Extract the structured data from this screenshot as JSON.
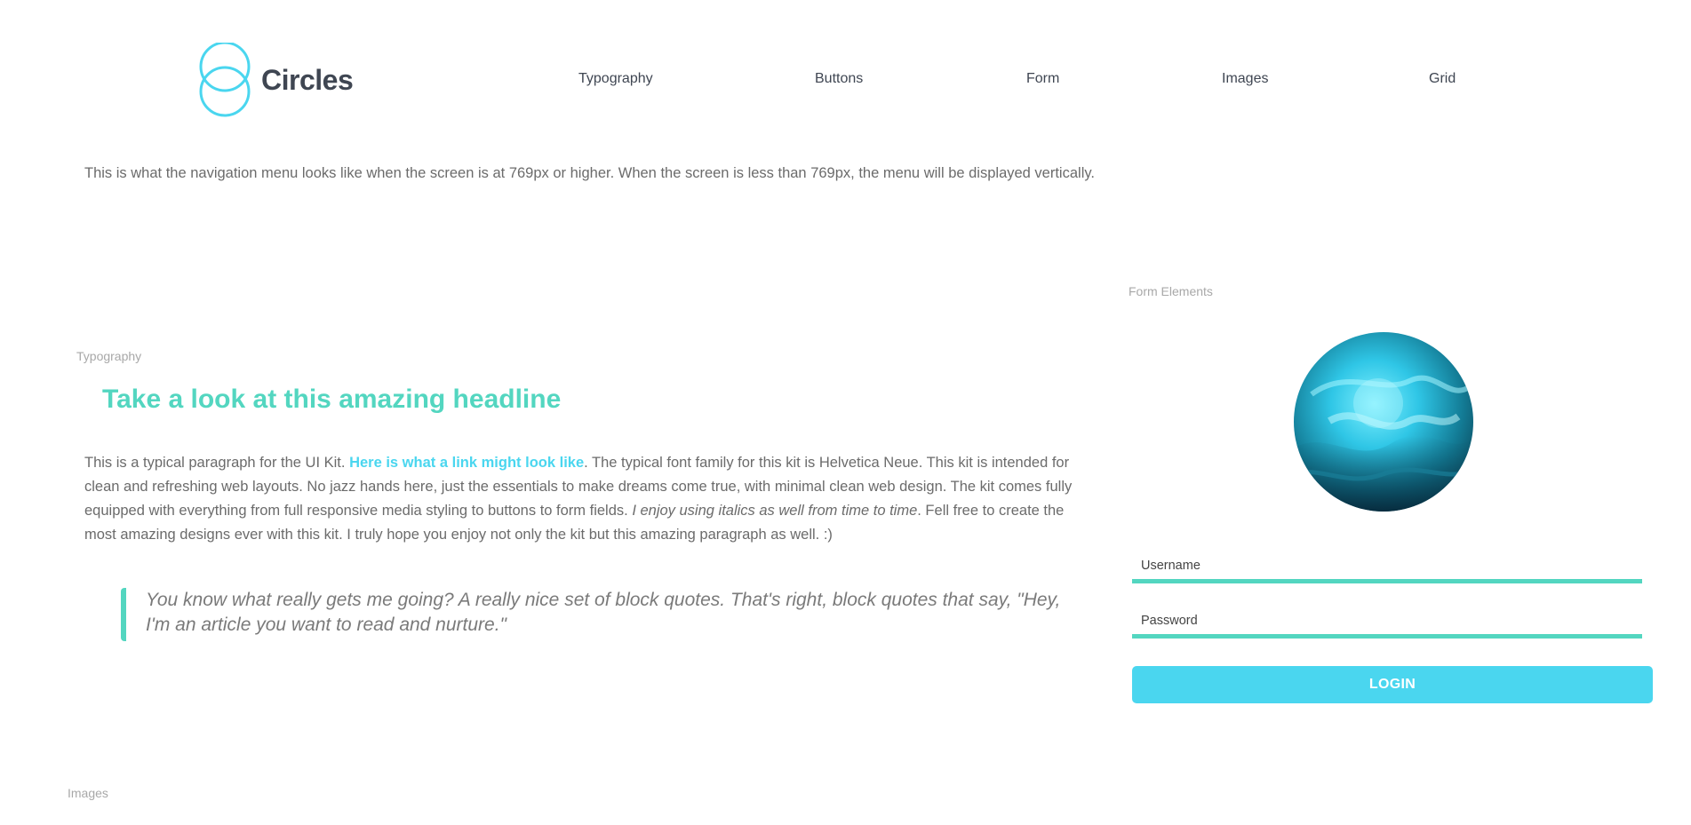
{
  "brand": {
    "name": "Circles",
    "accent": "#4ad6ef",
    "secondary": "#53d6c0"
  },
  "nav": {
    "items": [
      {
        "label": "Typography"
      },
      {
        "label": "Buttons"
      },
      {
        "label": "Form"
      },
      {
        "label": "Images"
      },
      {
        "label": "Grid"
      }
    ],
    "note": "This is what the navigation menu looks like when the screen is at 769px or higher. When the screen is less than 769px, the menu will be displayed vertically."
  },
  "typography": {
    "section_label": "Typography",
    "headline": "Take a look at this amazing headline",
    "para_part1": "This is a typical paragraph for the UI Kit. ",
    "link_text": "Here is what a link might look like",
    "para_part2": ". The typical font family for this kit is Helvetica Neue. This kit is intended for clean and refreshing web layouts. No jazz hands here, just the essentials to make dreams come true, with minimal clean web design. The kit comes fully equipped with everything from full responsive media styling to buttons to form fields. ",
    "italic_text": "I enjoy using italics as well from time to time",
    "para_part3": ". Fell free to create the most amazing designs ever with this kit. I truly hope you enjoy not only the kit but this amazing paragraph as well. :)",
    "blockquote": "You know what really gets me going? A really nice set of block quotes. That's right, block quotes that say, \"Hey, I'm an article you want to read and nurture.\""
  },
  "form": {
    "section_label": "Form Elements",
    "username_placeholder": "Username",
    "password_placeholder": "Password",
    "login_label": "LOGIN"
  },
  "images": {
    "section_label": "Images"
  }
}
